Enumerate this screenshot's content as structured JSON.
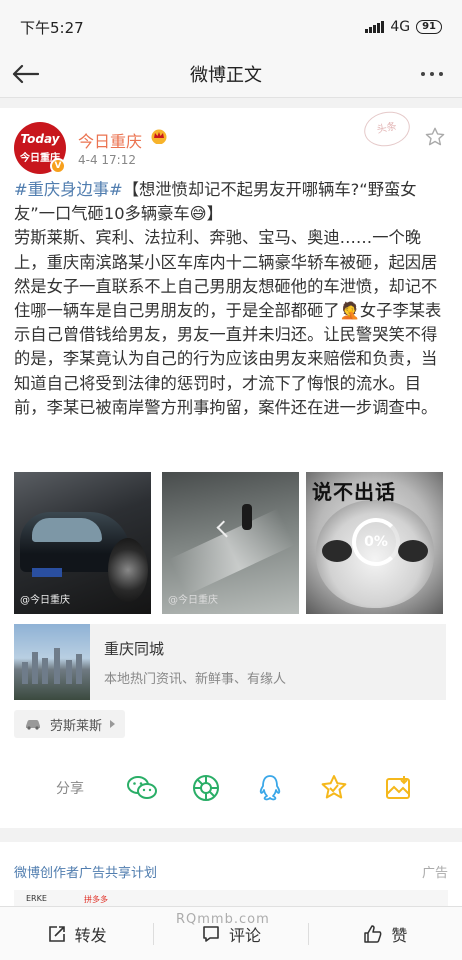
{
  "status_bar": {
    "time": "下午5:27",
    "network": "4G",
    "battery": "91"
  },
  "nav": {
    "title": "微博正文"
  },
  "post": {
    "author": "今日重庆",
    "avatar_top": "Today",
    "avatar_bottom": "今日重庆",
    "time": "4-4 17:12",
    "stamp": "头条",
    "topic_tag": "#重庆身边事#",
    "headline": "【想泄愤却记不起男友开哪辆车?“野蛮女友”一口气砸10多辆豪车😅】",
    "body": "劳斯莱斯、宾利、法拉利、奔驰、宝马、奥迪……一个晚上，重庆南滨路某小区车库内十二辆豪华轿车被砸，起因居然是女子一直联系不上自己男朋友想砸他的车泄愤，却记不住哪一辆车是自己男朋友的，于是全部都砸了🤦女子李某表示自己曾借钱给男友，男友一直并未归还。让民警哭笑不得的是，李某竟认为自己的行为应该由男友来赔偿和负责，当知道自己将受到法律的惩罚时，才流下了悔恨的流水。目前，李某已被南岸警方刑事拘留，案件还在进一步调查中。",
    "images": [
      {
        "watermark": "@今日重庆"
      },
      {
        "watermark": "@今日重庆"
      },
      {
        "caption": "说不出话",
        "loader": "0%"
      }
    ],
    "link_card": {
      "title": "重庆同城",
      "desc": "本地热门资讯、新鲜事、有缘人"
    },
    "topic_chip": "劳斯莱斯",
    "share_label": "分享"
  },
  "ad": {
    "title": "微博创作者广告共享计划",
    "label": "广告",
    "strip_a": "ERKE",
    "strip_b": "拼多多"
  },
  "toolbar": {
    "repost": "转发",
    "comment": "评论",
    "like": "赞"
  },
  "watermark": "RQmmb.com",
  "colors": {
    "accent_orange": "#eb7350",
    "link_blue": "#507daf",
    "star_yellow": "#f5b81c",
    "wechat_green": "#2aae67",
    "qq_blue": "#3aa7e8"
  }
}
